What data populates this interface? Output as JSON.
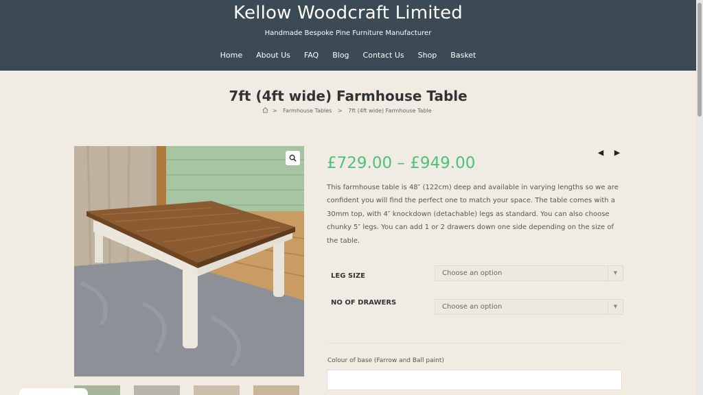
{
  "site": {
    "title": "Kellow Woodcraft Limited",
    "tagline": "Handmade Bespoke Pine Furniture Manufacturer"
  },
  "nav": [
    "Home",
    "About Us",
    "FAQ",
    "Blog",
    "Contact Us",
    "Shop",
    "Basket"
  ],
  "page": {
    "title": "7ft (4ft wide) Farmhouse Table",
    "breadcrumb": {
      "separator": ">",
      "items": [
        "Farmhouse Tables",
        "7ft (4ft wide) Farmhouse Table"
      ]
    }
  },
  "product": {
    "price": "£729.00 – £949.00",
    "description": "This farmhouse table is 48″ (122cm) deep and available in varying lengths so we are confident you will find the perfect one to match your space. The table comes with a 30mm top, with 4″ knockdown (detachable) legs as standard. You can also choose chunky 5″ legs. You can add 1 or 2 drawers down one side depending on the size of the table.",
    "variations": [
      {
        "label": "LEG SIZE",
        "placeholder": "Choose an option"
      },
      {
        "label": "NO OF DRAWERS",
        "placeholder": "Choose an option"
      }
    ],
    "colour_label": "Colour of base (Farrow and Ball paint)"
  },
  "icons": {
    "home": "home-icon",
    "zoom": "search-icon",
    "prev": "chevron-left-icon",
    "next": "chevron-right-icon",
    "select_caret": "chevron-down-icon"
  },
  "colors": {
    "header_bg": "#3b4a54",
    "page_bg": "#f0ece4",
    "price": "#4fc17a"
  }
}
